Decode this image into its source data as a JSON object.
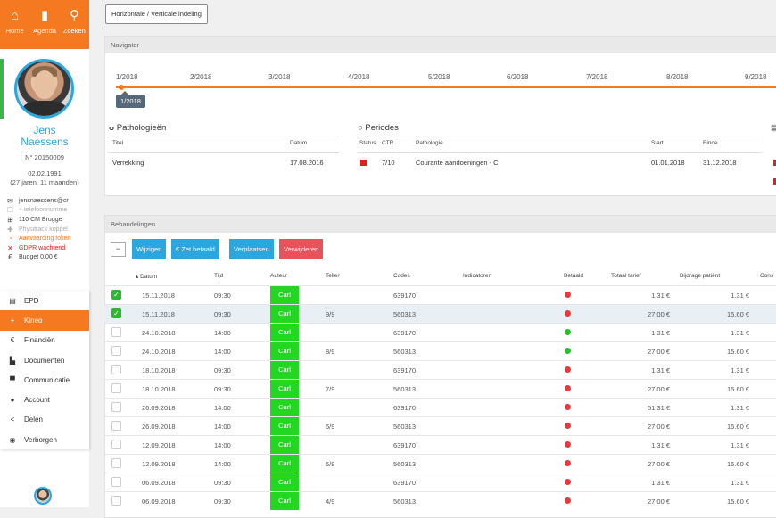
{
  "nav": [
    {
      "label": "Home",
      "icon": "home-icon",
      "glyph": "⌂"
    },
    {
      "label": "Agenda",
      "icon": "book-icon",
      "glyph": "▮"
    },
    {
      "label": "Zoeken",
      "icon": "search-icon",
      "glyph": "⚲"
    }
  ],
  "patient": {
    "first_name": "Jens",
    "last_name": "Naessens",
    "number": "N° 20150009",
    "birthdate": "02.02.1991",
    "age": "(27 jaren, 11 maanden)"
  },
  "contact": [
    {
      "icon": "envelope-icon",
      "glyph": "✉",
      "text": "jensnaessens@cr",
      "style": "normal"
    },
    {
      "icon": "phone-icon",
      "glyph": "☐",
      "text": "+ telefoonnumme",
      "style": "muted"
    },
    {
      "icon": "building-icon",
      "glyph": "⊞",
      "text": "110 CM Brugge",
      "style": "normal"
    },
    {
      "icon": "physiotrack-icon",
      "glyph": "✚",
      "text": "Physitrack koppel",
      "style": "muted"
    },
    {
      "icon": "clock-icon",
      "glyph": "◔",
      "text": "Aanvaarding token",
      "style": "orange"
    },
    {
      "icon": "cross-icon",
      "glyph": "✕",
      "text": "GDPR wachtend",
      "style": "red"
    },
    {
      "icon": "euro-icon",
      "glyph": "€",
      "text": "Budget  0.00 €",
      "style": "normal"
    }
  ],
  "menu": [
    {
      "label": "EPD",
      "icon": "card-icon",
      "glyph": "▤",
      "active": false
    },
    {
      "label": "Kineo",
      "icon": "plus-icon",
      "glyph": "+",
      "active": true
    },
    {
      "label": "Financiën",
      "icon": "euro-icon",
      "glyph": "€",
      "active": false
    },
    {
      "label": "Documenten",
      "icon": "document-icon",
      "glyph": "▙",
      "active": false
    },
    {
      "label": "Communicatie",
      "icon": "chat-icon",
      "glyph": "▀",
      "active": false
    },
    {
      "label": "Account",
      "icon": "user-icon",
      "glyph": "●",
      "active": false
    },
    {
      "label": "Delen",
      "icon": "share-icon",
      "glyph": "<",
      "active": false
    },
    {
      "label": "Verborgen",
      "icon": "eye-icon",
      "glyph": "◉",
      "active": false
    }
  ],
  "toggle_label": "Horizontale / Verticale indeling",
  "navigator": {
    "title": "Navigator",
    "months": [
      "1/2018",
      "2/2018",
      "3/2018",
      "4/2018",
      "5/2018",
      "6/2018",
      "7/2018",
      "8/2018",
      "9/2018"
    ],
    "selected": "1/2018"
  },
  "pathologieen": {
    "title": "Pathologieën",
    "headers": [
      "Titel",
      "Datum"
    ],
    "rows": [
      {
        "titel": "Verrekking",
        "datum": "17.08.2016"
      }
    ]
  },
  "periodes": {
    "title": "Periodes",
    "headers": [
      "Status",
      "CTR",
      "Pathologie",
      "Start",
      "Einde"
    ],
    "rows": [
      {
        "ctr": "7/10",
        "pathologie": "Courante aandoeningen - C",
        "start": "01.01.2018",
        "einde": "31.12.2018"
      }
    ]
  },
  "behandelingen": {
    "title": "Behandelingen",
    "buttons": {
      "wijzigen": "Wijzigen",
      "zet_betaald": "€ Zet betaald",
      "verplaatsen": "Verplaatsen",
      "verwijderen": "Verwijderen"
    },
    "collapse": "−",
    "headers": {
      "datum": "Datum",
      "tijd": "Tijd",
      "auteur": "Auteur",
      "teller": "Teller",
      "codes": "Codes",
      "indicatoren": "Indicatoren",
      "betaald": "Betaald",
      "totaal": "Totaal tarief",
      "bijdrage": "Bijdrage patiënt",
      "cons": "Cons"
    },
    "rows": [
      {
        "checked": true,
        "datum": "15.11.2018",
        "tijd": "09:30",
        "auteur": "Carl",
        "teller": "",
        "code": "639170",
        "paid": false,
        "totaal": "1.31 €",
        "bijdrage": "1.31 €"
      },
      {
        "checked": true,
        "datum": "15.11.2018",
        "tijd": "09:30",
        "auteur": "Carl",
        "teller": "9/9",
        "code": "560313",
        "paid": false,
        "totaal": "27.00 €",
        "bijdrage": "15.60 €"
      },
      {
        "checked": false,
        "datum": "24.10.2018",
        "tijd": "14:00",
        "auteur": "Carl",
        "teller": "",
        "code": "639170",
        "paid": true,
        "totaal": "1.31 €",
        "bijdrage": "1.31 €"
      },
      {
        "checked": false,
        "datum": "24.10.2018",
        "tijd": "14:00",
        "auteur": "Carl",
        "teller": "8/9",
        "code": "560313",
        "paid": true,
        "totaal": "27.00 €",
        "bijdrage": "15.60 €"
      },
      {
        "checked": false,
        "datum": "18.10.2018",
        "tijd": "09:30",
        "auteur": "Carl",
        "teller": "",
        "code": "639170",
        "paid": false,
        "totaal": "1.31 €",
        "bijdrage": "1.31 €"
      },
      {
        "checked": false,
        "datum": "18.10.2018",
        "tijd": "09:30",
        "auteur": "Carl",
        "teller": "7/9",
        "code": "560313",
        "paid": false,
        "totaal": "27.00 €",
        "bijdrage": "15.60 €"
      },
      {
        "checked": false,
        "datum": "26.09.2018",
        "tijd": "14:00",
        "auteur": "Carl",
        "teller": "",
        "code": "639170",
        "paid": false,
        "totaal": "51.31 €",
        "bijdrage": "1.31 €"
      },
      {
        "checked": false,
        "datum": "26.09.2018",
        "tijd": "14:00",
        "auteur": "Carl",
        "teller": "6/9",
        "code": "560313",
        "paid": false,
        "totaal": "27.00 €",
        "bijdrage": "15.60 €"
      },
      {
        "checked": false,
        "datum": "12.09.2018",
        "tijd": "14:00",
        "auteur": "Carl",
        "teller": "",
        "code": "639170",
        "paid": false,
        "totaal": "1.31 €",
        "bijdrage": "1.31 €"
      },
      {
        "checked": false,
        "datum": "12.09.2018",
        "tijd": "14:00",
        "auteur": "Carl",
        "teller": "5/9",
        "code": "560313",
        "paid": false,
        "totaal": "27.00 €",
        "bijdrage": "15.60 €"
      },
      {
        "checked": false,
        "datum": "06.09.2018",
        "tijd": "09:30",
        "auteur": "Carl",
        "teller": "",
        "code": "639170",
        "paid": false,
        "totaal": "1.31 €",
        "bijdrage": "1.31 €"
      },
      {
        "checked": false,
        "datum": "06.09.2018",
        "tijd": "09:30",
        "auteur": "Carl",
        "teller": "4/9",
        "code": "560313",
        "paid": false,
        "totaal": "27.00 €",
        "bijdrage": "15.60 €"
      }
    ]
  },
  "colors": {
    "orange": "#f47920",
    "blue": "#2ba6de",
    "green": "#22d622",
    "red": "#e02020",
    "paid_green": "#22c22a",
    "unpaid_red": "#e83a3a"
  }
}
